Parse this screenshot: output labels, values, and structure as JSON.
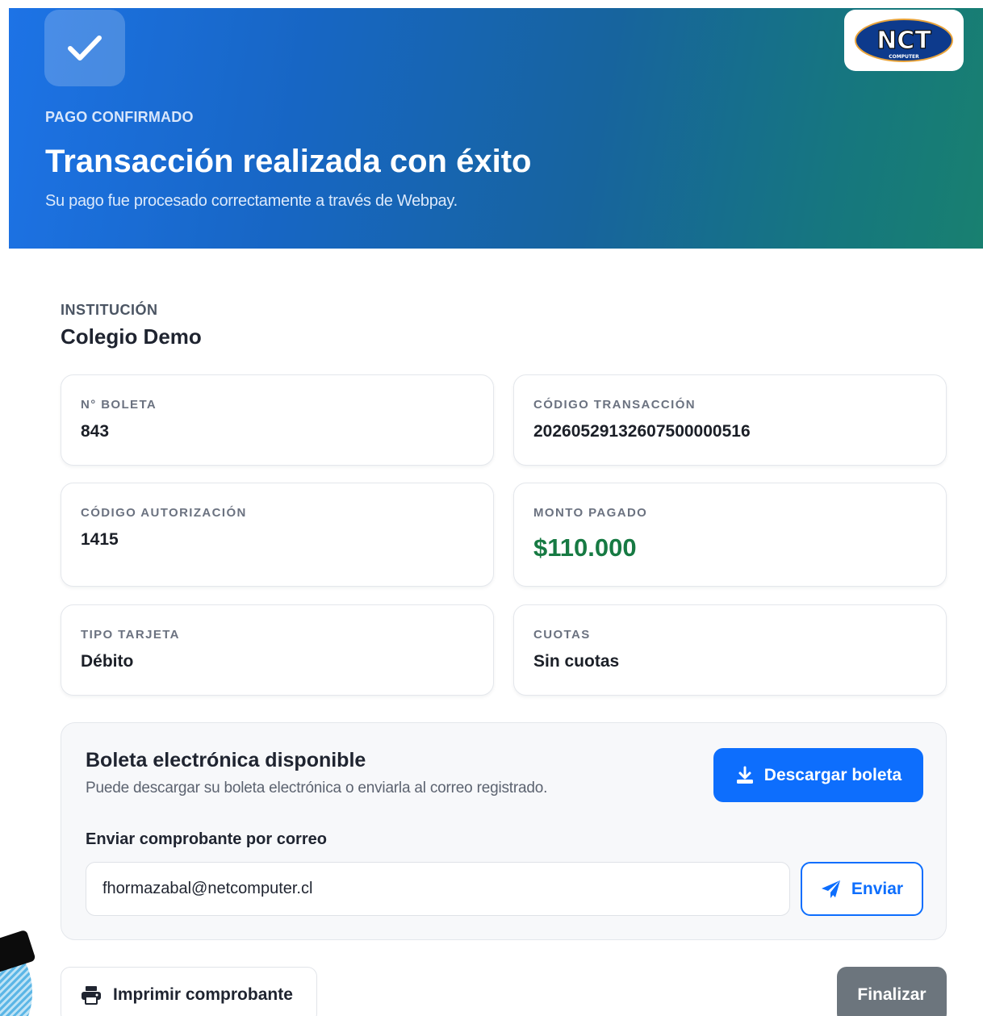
{
  "header": {
    "eyebrow": "PAGO CONFIRMADO",
    "title": "Transacción realizada con éxito",
    "subtitle": "Su pago fue procesado correctamente a través de Webpay.",
    "logo_text": "NCT",
    "logo_subtext": "COMPUTER"
  },
  "institution": {
    "label": "INSTITUCIÓN",
    "name": "Colegio Demo"
  },
  "details": [
    {
      "label": "N° BOLETA",
      "value": "843"
    },
    {
      "label": "CÓDIGO TRANSACCIÓN",
      "value": "20260529132607500000516"
    },
    {
      "label": "CÓDIGO AUTORIZACIÓN",
      "value": "1415"
    },
    {
      "label": "MONTO PAGADO",
      "value": "$110.000"
    },
    {
      "label": "TIPO TARJETA",
      "value": "Débito"
    },
    {
      "label": "CUOTAS",
      "value": "Sin cuotas"
    }
  ],
  "boleta": {
    "title": "Boleta electrónica disponible",
    "description": "Puede descargar su boleta electrónica o enviarla al correo registrado.",
    "download_label": "Descargar boleta",
    "email_label": "Enviar comprobante por correo",
    "email_value": "fhormazabal@netcomputer.cl",
    "send_label": "Enviar"
  },
  "actions": {
    "print_label": "Imprimir comprobante",
    "finish_label": "Finalizar"
  },
  "colors": {
    "primary": "#0d6efd",
    "amount": "#177a43",
    "finish": "#6c757d"
  }
}
